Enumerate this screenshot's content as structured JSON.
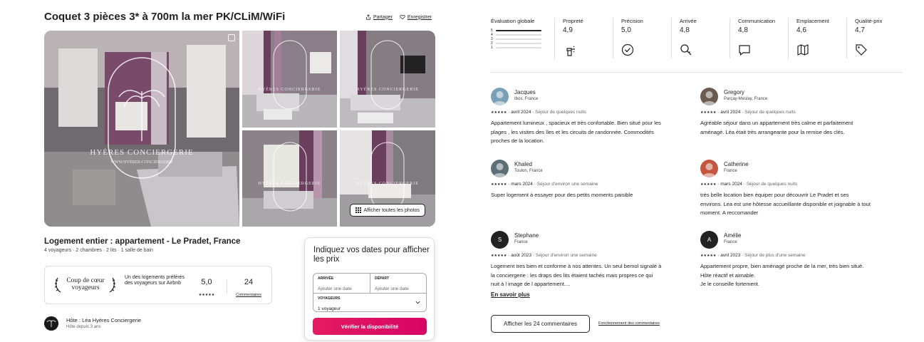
{
  "listing": {
    "title": "Coquet 3 pièces 3* à 700m la mer PK/CLiM/WiFi",
    "share_label": "Partager",
    "save_label": "Enregistrer",
    "show_all_photos": "Afficher toutes les photos",
    "watermark": "HYÈRES CONCIERGERIE",
    "watermark_url": "WWW.HYERES-CONCIERGERIE",
    "heading": "Logement entier : appartement - Le Pradet, France",
    "details": "4 voyageurs · 2 chambres · 2 lits · 1 salle de bain"
  },
  "favorite": {
    "title": "Coup de cœur voyageurs",
    "text": "Un des logements préférés des voyageurs sur Airbnb",
    "rating": "5,0",
    "stars": "★★★★★",
    "review_count": "24",
    "review_label": "Commentaires"
  },
  "host": {
    "name": "Hôte : Léa Hyères Conciergerie",
    "since": "Hôte depuis 3 ans"
  },
  "booking": {
    "title": "Indiquez vos dates pour afficher les prix",
    "arrival_label": "ARRIVÉE",
    "arrival_placeholder": "Ajouter une date",
    "departure_label": "DÉPART",
    "departure_placeholder": "Ajouter une date",
    "guests_label": "VOYAGEURS",
    "guests_value": "1 voyageur",
    "check_button": "Vérifier la disponibilité"
  },
  "ratings": {
    "overall_label": "Évaluation globale",
    "distribution": [
      {
        "stars": "5",
        "fraction": 1.0
      },
      {
        "stars": "4",
        "fraction": 0.0
      },
      {
        "stars": "3",
        "fraction": 0.0
      },
      {
        "stars": "2",
        "fraction": 0.0
      },
      {
        "stars": "1",
        "fraction": 0.0
      }
    ],
    "categories": [
      {
        "label": "Propreté",
        "value": "4,9",
        "icon": "spray-icon"
      },
      {
        "label": "Précision",
        "value": "5,0",
        "icon": "check-circle-icon"
      },
      {
        "label": "Arrivée",
        "value": "4,8",
        "icon": "key-icon"
      },
      {
        "label": "Communication",
        "value": "4,8",
        "icon": "message-icon"
      },
      {
        "label": "Emplacement",
        "value": "4,6",
        "icon": "map-icon"
      },
      {
        "label": "Qualité-prix",
        "value": "4,7",
        "icon": "tag-icon"
      }
    ]
  },
  "reviews": [
    {
      "name": "Jacques",
      "location": "Ibos, France",
      "avatar": "photo",
      "stars": "★★★★★",
      "date": "avril 2024",
      "stay": "Séjour de quelques nuits",
      "text": "Appartement lumineux , spacieux et très confortable. Bien situé pour les plages , les visites des îles et les circuits de randonnée. Commodités proches de la location."
    },
    {
      "name": "Gregory",
      "location": "Parçay-Meslay, France",
      "avatar": "photo",
      "stars": "★★★★★",
      "date": "avril 2024",
      "stay": "Séjour de quelques nuits",
      "text": "Agréable séjour dans un appartement très calme et parfaitement aménagé. Léa était très arrangeante pour la remise des clés."
    },
    {
      "name": "Khaled",
      "location": "Toulon, France",
      "avatar": "photo",
      "stars": "★★★★★",
      "date": "mars 2024",
      "stay": "Séjour d'environ une semaine",
      "text": "Super logement à essayer pour des petits moments paisible"
    },
    {
      "name": "Catherine",
      "location": "France",
      "avatar": "photo",
      "stars": "★★★★★",
      "date": "mars 2024",
      "stay": "Séjour de quelques nuits",
      "text": "très belle location bien équiper pour découvrir Le Pradet et ses environs. Lea est une hôtesse accueillante disponible et joignable à tout moment. A reccomander"
    },
    {
      "name": "Stephane",
      "location": "France",
      "avatar": "letter",
      "initial": "S",
      "stars": "★★★★★",
      "date": "août 2023",
      "stay": "Séjour d'environ une semaine",
      "text": "Logement tres bien et conforme à nos attentes. Un seul bemol signalé à la conciergerie : les draps des lits étaient tachés mais propres ce qui nuit à l image de l appartement....",
      "more": "En savoir plus"
    },
    {
      "name": "Amélie",
      "location": "France",
      "avatar": "letter",
      "initial": "A",
      "stars": "★★★★★",
      "date": "avril 2023",
      "stay": "Séjour de plus d'une semaine",
      "text": "Appartement propre, bien aménagé proche de la mer, très bien situé. Hôte réactif et aimable.\nJe le conseille fortement."
    }
  ],
  "footer": {
    "show_all_reviews": "Afficher les 24 commentaires",
    "how_reviews_work": "Fonctionnement des commentaires"
  }
}
